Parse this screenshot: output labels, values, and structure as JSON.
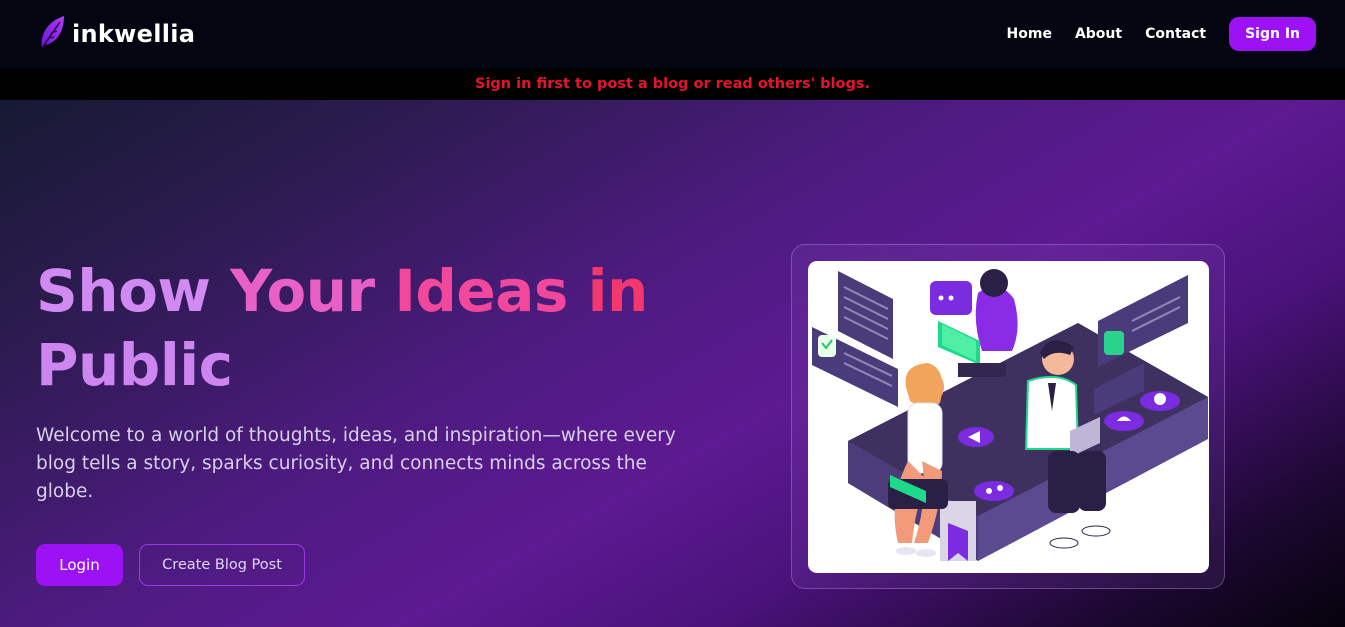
{
  "brand": {
    "name": "inkwellia",
    "icon": "leaf-icon",
    "accent": "#9d12f5"
  },
  "nav": {
    "links": [
      {
        "label": "Home"
      },
      {
        "label": "About"
      },
      {
        "label": "Contact"
      }
    ],
    "signin_label": "Sign In"
  },
  "alert": {
    "text": "Sign in first to post a blog or read others' blogs.",
    "color": "#e5142b"
  },
  "hero": {
    "title_words": [
      "Show",
      "Your",
      "Ideas",
      "in",
      "Public"
    ],
    "description": "Welcome to a world of thoughts, ideas, and inspiration—where every blog tells a story, sparks curiosity, and connects minds across the globe.",
    "login_label": "Login",
    "create_label": "Create Blog Post"
  },
  "illustration": {
    "subject": "people-blogging-illustration"
  }
}
